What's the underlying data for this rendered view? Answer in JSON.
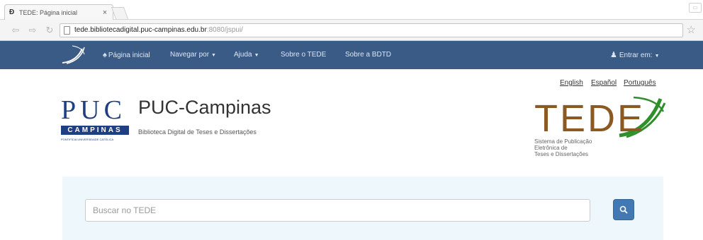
{
  "browser": {
    "tab_title": "TEDE: Página inicial",
    "tab_close": "×",
    "url_host": "tede.bibliotecadigital.puc-campinas.edu.br",
    "url_rest": ":8080/jspui/"
  },
  "navbar": {
    "home": "Página inicial",
    "browse": "Navegar por",
    "help": "Ajuda",
    "about_tede": "Sobre o TEDE",
    "about_bdtd": "Sobre a BDTD",
    "login": "Entrar em:"
  },
  "languages": [
    "English",
    "Español",
    "Português"
  ],
  "header": {
    "puc_letters": "PUC",
    "puc_band": "CAMPINAS",
    "puc_tagline": "PONTIFÍCIA UNIVERSIDADE CATÓLICA",
    "title": "PUC-Campinas",
    "subtitle": "Biblioteca Digital de Teses e Dissertações"
  },
  "tede_logo": {
    "word": "TEDE",
    "line1": "Sistema de Publicação",
    "line2": "Eletrônica de",
    "line3": "Teses e Dissertações"
  },
  "search": {
    "placeholder": "Buscar no TEDE"
  },
  "colors": {
    "navbar": "#3b5b87",
    "puc_blue": "#1e3f82",
    "tede_brown": "#8a5a22",
    "tede_green": "#2f8f2a",
    "search_button": "#4279b5",
    "jumbotron": "#eef7fb"
  }
}
